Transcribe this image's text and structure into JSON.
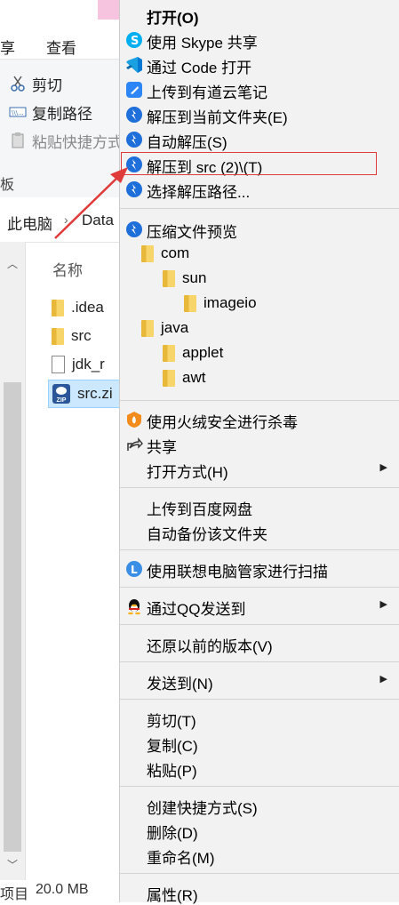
{
  "explorer": {
    "ribbon_tabs": [
      "享",
      "查看"
    ],
    "ribbon_items": [
      {
        "label": "剪切",
        "icon": "scissors-icon",
        "disabled": false
      },
      {
        "label": "复制路径",
        "icon": "copy-path-icon",
        "disabled": false
      },
      {
        "label": "粘贴快捷方式",
        "icon": "paste-shortcut-icon",
        "disabled": true
      }
    ],
    "ribbon_stub": "板",
    "address": {
      "part1": "此电脑",
      "part2": "Data"
    },
    "column_header": "名称",
    "files": [
      {
        "name": ".idea",
        "type": "folder"
      },
      {
        "name": "src",
        "type": "folder"
      },
      {
        "name": "jdk_r",
        "type": "file"
      },
      {
        "name": "src.zi",
        "type": "zip",
        "selected": true
      }
    ],
    "status": {
      "items": "项目",
      "size": "20.0 MB"
    }
  },
  "menu": {
    "open": "打开(O)",
    "skype_share": "使用 Skype 共享",
    "open_code": "通过 Code 打开",
    "youdao": "上传到有道云笔记",
    "extract_here": "解压到当前文件夹(E)",
    "auto_extract": "自动解压(S)",
    "extract_to": "解压到 src (2)\\(T)",
    "choose_path": "选择解压路径...",
    "preview": "压缩文件预览",
    "tree": {
      "com": "com",
      "sun": "sun",
      "imageio": "imageio",
      "java": "java",
      "applet": "applet",
      "awt": "awt"
    },
    "huorong": "使用火绒安全进行杀毒",
    "share": "共享",
    "open_with": "打开方式(H)",
    "baidu_upload": "上传到百度网盘",
    "auto_backup": "自动备份该文件夹",
    "lenovo_scan": "使用联想电脑管家进行扫描",
    "qq_send": "通过QQ发送到",
    "restore": "还原以前的版本(V)",
    "send_to": "发送到(N)",
    "cut": "剪切(T)",
    "copy": "复制(C)",
    "paste": "粘贴(P)",
    "create_shortcut": "创建快捷方式(S)",
    "delete": "删除(D)",
    "rename": "重命名(M)",
    "properties": "属性(R)"
  },
  "colors": {
    "highlight_border": "#e03b3b",
    "menu_bg": "#f2f2f2",
    "selection": "#cce8ff",
    "bandizip_blue": "#1e6fd9"
  }
}
